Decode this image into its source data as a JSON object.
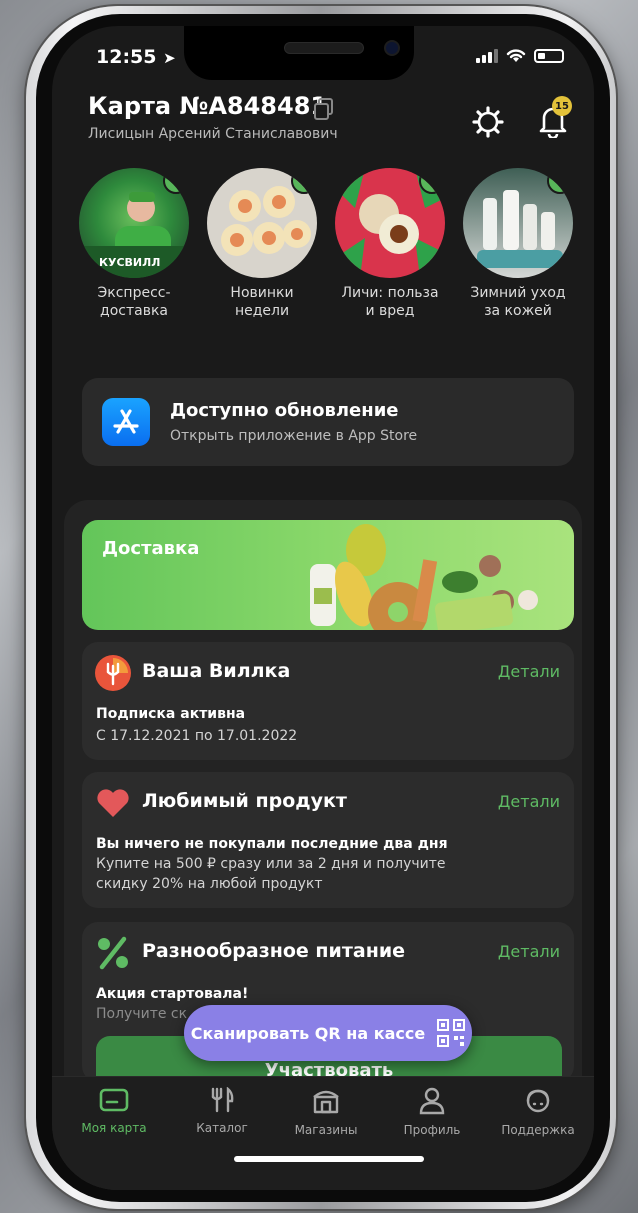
{
  "status_bar": {
    "time": "12:55"
  },
  "header": {
    "card_title": "Карта №A848481",
    "owner_name": "Лисицын Арсений Станиславович",
    "notification_count": "15"
  },
  "stories": [
    {
      "label": "Экспресс-\nдоставка"
    },
    {
      "label": "Новинки\nнедели"
    },
    {
      "label": "Личи: польза\nи вред"
    },
    {
      "label": "Зимний уход\nза кожей"
    }
  ],
  "update_card": {
    "title": "Доступно обновление",
    "subtitle": "Открыть приложение в App Store"
  },
  "delivery_banner": {
    "label": "Доставка"
  },
  "cards": {
    "vilka": {
      "title": "Ваша Виллка",
      "details": "Детали",
      "status": "Подписка активна",
      "period": "С 17.12.2021 по 17.01.2022"
    },
    "favorite": {
      "title": "Любимый продукт",
      "details": "Детали",
      "status": "Вы ничего не покупали последние два дня",
      "description": "Купите на 500 ₽ сразу или за 2 дня и получите скидку 20% на любой продукт"
    },
    "variety": {
      "title": "Разнообразное питание",
      "details": "Детали",
      "status": "Акция стартовала!",
      "description": "Получите ск"
    }
  },
  "participate_button": "Участвовать",
  "scan_qr_button": "Сканировать QR на кассе",
  "tabbar": [
    {
      "label": "Моя карта",
      "icon": "card-icon",
      "active": true
    },
    {
      "label": "Каталог",
      "icon": "fork-knife-icon",
      "active": false
    },
    {
      "label": "Магазины",
      "icon": "store-icon",
      "active": false
    },
    {
      "label": "Профиль",
      "icon": "person-icon",
      "active": false
    },
    {
      "label": "Поддержка",
      "icon": "headset-icon",
      "active": false
    }
  ],
  "colors": {
    "accent_green": "#5fbb64",
    "background": "#1a1a1a",
    "card": "#2c2c2c",
    "qr_pill": "#8a80e6",
    "badge": "#e3c23a"
  }
}
